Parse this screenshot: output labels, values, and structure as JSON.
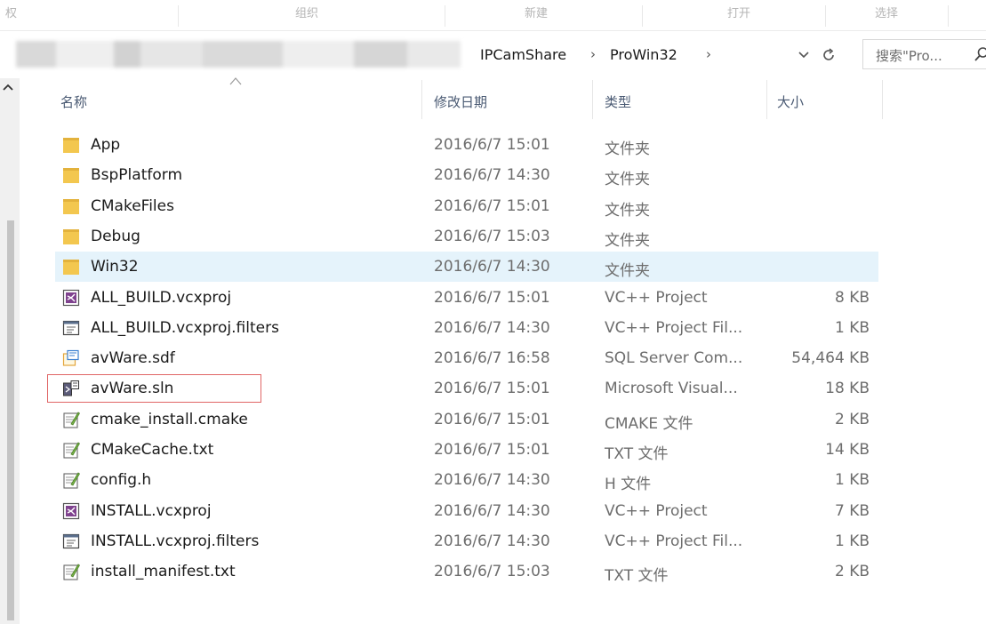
{
  "ribbon": {
    "groups": [
      "权",
      "组织",
      "新建",
      "打开",
      "选择"
    ]
  },
  "address": {
    "crumbs": [
      "IPCamShare",
      "ProWin32"
    ],
    "search_placeholder": "搜索\"Pro... "
  },
  "columns": {
    "name": "名称",
    "date": "修改日期",
    "type": "类型",
    "size": "大小"
  },
  "files": [
    {
      "name": "App",
      "date": "2016/6/7 15:01",
      "type": "文件夹",
      "size": "",
      "icon": "folder-icon"
    },
    {
      "name": "BspPlatform",
      "date": "2016/6/7 14:30",
      "type": "文件夹",
      "size": "",
      "icon": "folder-icon"
    },
    {
      "name": "CMakeFiles",
      "date": "2016/6/7 15:01",
      "type": "文件夹",
      "size": "",
      "icon": "folder-icon"
    },
    {
      "name": "Debug",
      "date": "2016/6/7 15:03",
      "type": "文件夹",
      "size": "",
      "icon": "folder-icon"
    },
    {
      "name": "Win32",
      "date": "2016/6/7 14:30",
      "type": "文件夹",
      "size": "",
      "icon": "folder-icon",
      "highlighted": true
    },
    {
      "name": "ALL_BUILD.vcxproj",
      "date": "2016/6/7 15:01",
      "type": "VC++ Project",
      "size": "8 KB",
      "icon": "vcxproj-icon"
    },
    {
      "name": "ALL_BUILD.vcxproj.filters",
      "date": "2016/6/7 14:30",
      "type": "VC++ Project Fil...",
      "size": "1 KB",
      "icon": "filters-icon"
    },
    {
      "name": "avWare.sdf",
      "date": "2016/6/7 16:58",
      "type": "SQL Server Com...",
      "size": "54,464 KB",
      "icon": "sdf-icon"
    },
    {
      "name": "avWare.sln",
      "date": "2016/6/7 15:01",
      "type": "Microsoft Visual...",
      "size": "18 KB",
      "icon": "sln-icon",
      "boxed": true
    },
    {
      "name": "cmake_install.cmake",
      "date": "2016/6/7 15:01",
      "type": "CMAKE 文件",
      "size": "2 KB",
      "icon": "text-file-icon"
    },
    {
      "name": "CMakeCache.txt",
      "date": "2016/6/7 15:01",
      "type": "TXT 文件",
      "size": "14 KB",
      "icon": "text-file-icon"
    },
    {
      "name": "config.h",
      "date": "2016/6/7 14:30",
      "type": "H 文件",
      "size": "1 KB",
      "icon": "text-file-icon"
    },
    {
      "name": "INSTALL.vcxproj",
      "date": "2016/6/7 14:30",
      "type": "VC++ Project",
      "size": "7 KB",
      "icon": "vcxproj-icon"
    },
    {
      "name": "INSTALL.vcxproj.filters",
      "date": "2016/6/7 14:30",
      "type": "VC++ Project Fil...",
      "size": "1 KB",
      "icon": "filters-icon"
    },
    {
      "name": "install_manifest.txt",
      "date": "2016/6/7 15:03",
      "type": "TXT 文件",
      "size": "2 KB",
      "icon": "text-file-icon"
    }
  ],
  "colors": {
    "highlight_row": "#e5f3fb",
    "selection_box": "#e06666",
    "folder": "#f3c74f",
    "header_text": "#4a5a73"
  }
}
